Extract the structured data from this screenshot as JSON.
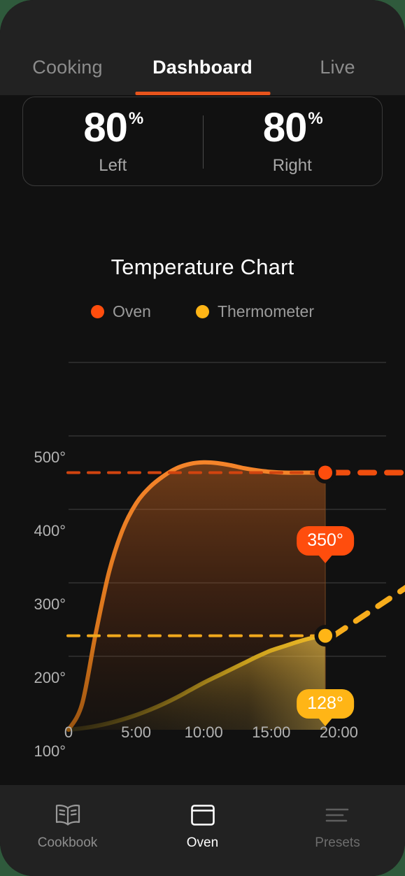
{
  "app": {
    "accent": "#e8541c",
    "background": "#111111",
    "surface": "#222222",
    "outside_backdrop": "#2f5a3c"
  },
  "tabs": [
    {
      "label": "Cooking",
      "active": false
    },
    {
      "label": "Dashboard",
      "active": true
    },
    {
      "label": "Live",
      "active": false
    }
  ],
  "power_card": {
    "left": {
      "value": "80",
      "unit": "%",
      "label": "Left"
    },
    "right": {
      "value": "80",
      "unit": "%",
      "label": "Right"
    }
  },
  "chart_data": {
    "type": "line",
    "title": "Temperature Chart",
    "xlabel": "",
    "ylabel": "",
    "grid": true,
    "legend_position": "top-center",
    "xlim": [
      0,
      23.5
    ],
    "ylim": [
      0,
      540
    ],
    "ytick_labels": [
      "500°",
      "400°",
      "300°",
      "200°",
      "100°"
    ],
    "ytick_values": [
      500,
      400,
      300,
      200,
      100
    ],
    "xtick_labels": [
      "0",
      "5:00",
      "10:00",
      "15:00",
      "20:00"
    ],
    "xtick_values": [
      0,
      5,
      10,
      15,
      20
    ],
    "series": [
      {
        "name": "Oven",
        "color": "#FF4D0D",
        "line_color": "#ef7722",
        "fill": true,
        "current_value": 350,
        "current_label": "350°",
        "target_line": 350,
        "projection": "flat-dashed",
        "x": [
          0,
          1,
          2,
          3,
          4,
          5,
          6,
          7,
          8,
          9,
          10,
          11,
          12,
          13,
          14,
          15,
          16,
          17,
          18,
          19
        ],
        "values": [
          0,
          35,
          130,
          215,
          272,
          308,
          330,
          345,
          356,
          362,
          364,
          363,
          360,
          356,
          353,
          351,
          350,
          350,
          350,
          350
        ]
      },
      {
        "name": "Thermometer",
        "color": "#FFB516",
        "line_color": "#d9a21b",
        "fill": true,
        "current_value": 128,
        "current_label": "128°",
        "target_line": 128,
        "projection": "rising-dashed",
        "x": [
          0,
          1,
          2,
          3,
          4,
          5,
          6,
          7,
          8,
          9,
          10,
          11,
          12,
          13,
          14,
          15,
          16,
          17,
          18,
          19
        ],
        "values": [
          0,
          2,
          5,
          9,
          14,
          20,
          27,
          35,
          44,
          54,
          64,
          73,
          82,
          91,
          100,
          108,
          114,
          120,
          125,
          128
        ]
      }
    ],
    "markers": [
      {
        "series": "Oven",
        "x": 19,
        "y": 350,
        "label": "350°",
        "color": "#FF4D0D"
      },
      {
        "series": "Thermometer",
        "x": 19,
        "y": 128,
        "label": "128°",
        "color": "#FFB516"
      }
    ]
  },
  "legend": [
    {
      "label": "Oven",
      "color": "#FF4D0D"
    },
    {
      "label": "Thermometer",
      "color": "#FFB516"
    }
  ],
  "bottom_nav": [
    {
      "label": "Cookbook",
      "icon": "book-icon",
      "state": "dim"
    },
    {
      "label": "Oven",
      "icon": "oven-icon",
      "state": "active"
    },
    {
      "label": "Presets",
      "icon": "list-icon",
      "state": "faint"
    }
  ]
}
